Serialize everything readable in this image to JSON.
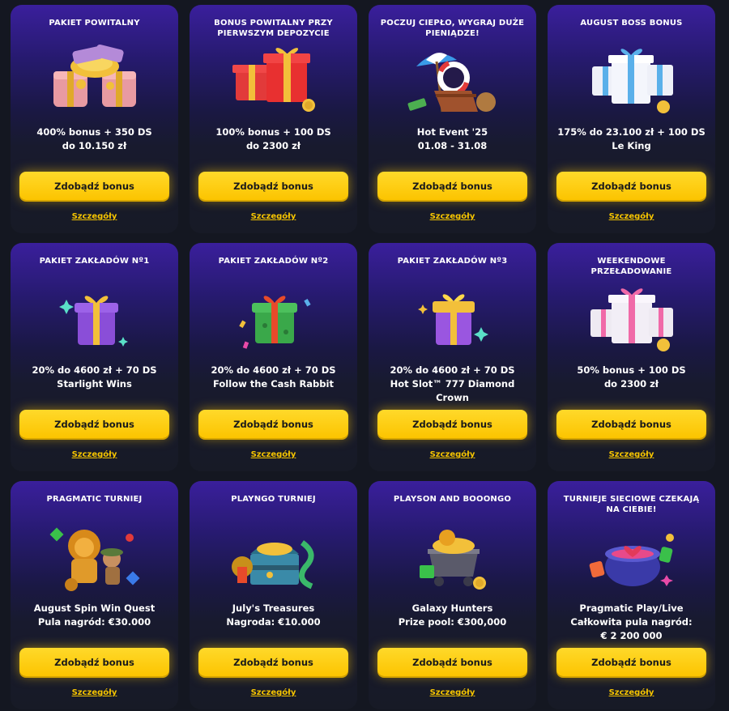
{
  "cta_color": "#fcc400",
  "cards": [
    {
      "title": "PAKIET POWITALNY",
      "desc": [
        "400% bonus + 350 DS",
        "do 10.150 zł"
      ],
      "button": "Zdobądź bonus",
      "details": "Szczegóły",
      "icon": "treasure-chests-icon"
    },
    {
      "title": "BONUS POWITALNY PRZY PIERWSZYM DEPOZYCIE",
      "desc": [
        "100% bonus + 100 DS",
        "do 2300 zł"
      ],
      "button": "Zdobądź bonus",
      "details": "Szczegóły",
      "icon": "red-gifts-icon"
    },
    {
      "title": "POCZUJ CIEPŁO, WYGRAJ DUŻE PIENIĄDZE!",
      "desc": [
        "Hot Event '25",
        "01.08 - 31.08"
      ],
      "button": "Zdobądź bonus",
      "details": "Szczegóły",
      "icon": "beach-chair-icon"
    },
    {
      "title": "AUGUST BOSS BONUS",
      "desc": [
        "175% do 23.100 zł + 100 DS",
        "Le King"
      ],
      "button": "Zdobądź bonus",
      "details": "Szczegóły",
      "icon": "white-gifts-icon"
    },
    {
      "title": "PAKIET ZAKŁADÓW Nº1",
      "desc": [
        "20% do 4600 zł + 70 DS",
        "Starlight Wins"
      ],
      "button": "Zdobądź bonus",
      "details": "Szczegóły",
      "icon": "purple-gift-icon"
    },
    {
      "title": "PAKIET ZAKŁADÓW Nº2",
      "desc": [
        "20% do 4600 zł + 70 DS",
        "Follow the Cash Rabbit"
      ],
      "button": "Zdobądź bonus",
      "details": "Szczegóły",
      "icon": "green-gift-icon"
    },
    {
      "title": "PAKIET ZAKŁADÓW Nº3",
      "desc": [
        "20% do 4600 zł + 70 DS",
        "Hot Slot™ 777 Diamond Crown"
      ],
      "button": "Zdobądź bonus",
      "details": "Szczegóły",
      "icon": "yellow-gift-icon"
    },
    {
      "title": "WEEKENDOWE PRZEŁADOWANIE",
      "desc": [
        "50% bonus + 100 DS",
        "do 2300 zł"
      ],
      "button": "Zdobądź bonus",
      "details": "Szczegóły",
      "icon": "pink-gifts-icon"
    },
    {
      "title": "PRAGMATIC TURNIEJ",
      "desc": [
        "August Spin Win Quest",
        "Pula nagród: €30.000"
      ],
      "button": "Zdobądź bonus",
      "details": "Szczegóły",
      "icon": "golden-lion-icon"
    },
    {
      "title": "PLAYNGO TURNIEJ",
      "desc": [
        "July's Treasures",
        "Nagroda: €10.000"
      ],
      "button": "Zdobądź bonus",
      "details": "Szczegóły",
      "icon": "treasure-chest-icon"
    },
    {
      "title": "PLAYSON AND BOOONGO",
      "desc": [
        "Galaxy Hunters",
        "Prize pool: €300,000"
      ],
      "button": "Zdobądź bonus",
      "details": "Szczegóły",
      "icon": "mine-cart-icon"
    },
    {
      "title": "TURNIEJE SIECIOWE CZEKAJĄ NA CIEBIE!",
      "desc": [
        "Pragmatic Play/Live",
        "Całkowita pula nagród:",
        "€ 2 200 000"
      ],
      "button": "Zdobądź bonus",
      "details": "Szczegóły",
      "icon": "cauldron-icon"
    }
  ]
}
